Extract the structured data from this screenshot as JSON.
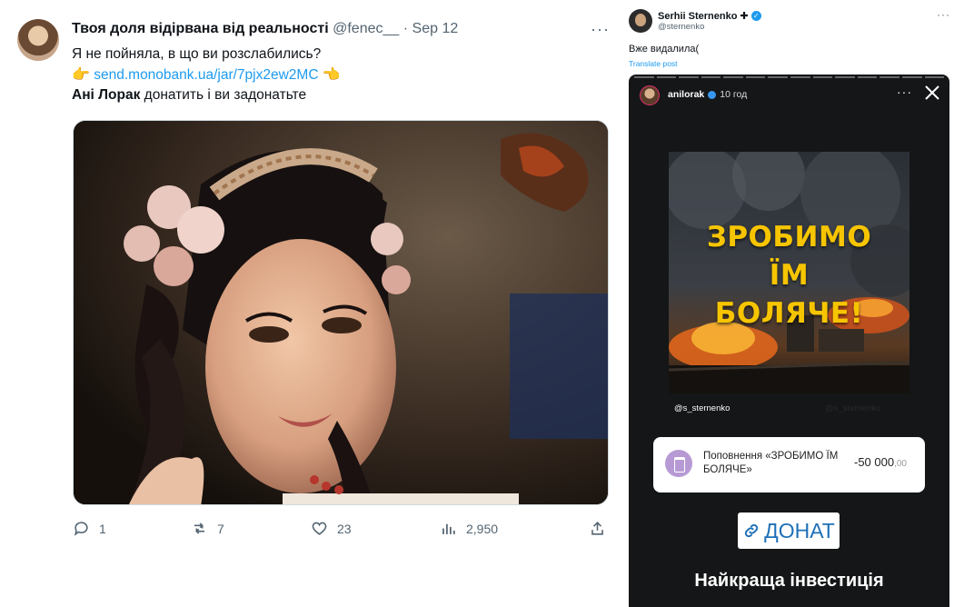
{
  "tweet": {
    "author_name": "Твоя доля відірвана від реальності",
    "handle": "@fenec__",
    "separator": "·",
    "date": "Sep 12",
    "more": "···",
    "line1": "Я не пойняла, в що ви розслабились?",
    "line2_left_emoji": "👉",
    "line2_link": "send.monobank.ua/jar/7pjx2ew2MC",
    "line2_right_emoji": "👈",
    "line3_bold": "Ані Лорак",
    "line3_rest": " донатить і ви задонатьте",
    "actions": {
      "replies": "1",
      "reposts": "7",
      "likes": "23",
      "views": "2,950"
    }
  },
  "post": {
    "author_name": "Serhii Sternenko ✚",
    "handle": "@sternenko",
    "more": "···",
    "text": "Вже видалила(",
    "translate": "Translate post",
    "story": {
      "username": "anilorak",
      "time": "10 год",
      "more": "···",
      "poster_lines": [
        "ЗРОБИМО",
        "ЇМ",
        "БОЛЯЧЕ!"
      ],
      "mention": "@s_sternenko",
      "mention_ghost": "@s_sternenko",
      "transaction": {
        "title": "Поповнення «ЗРОБИМО ЇМ БОЛЯЧЕ»",
        "amount": "-50 000",
        "cents": ",00"
      },
      "donate_label": "ДОНАТ",
      "caption": "Найкраща інвестиція"
    }
  },
  "colors": {
    "link": "#1d9bf0",
    "muted": "#536471",
    "story_bg": "#141617",
    "poster_yellow": "#f7c500",
    "donate_blue": "#1e70b8"
  }
}
